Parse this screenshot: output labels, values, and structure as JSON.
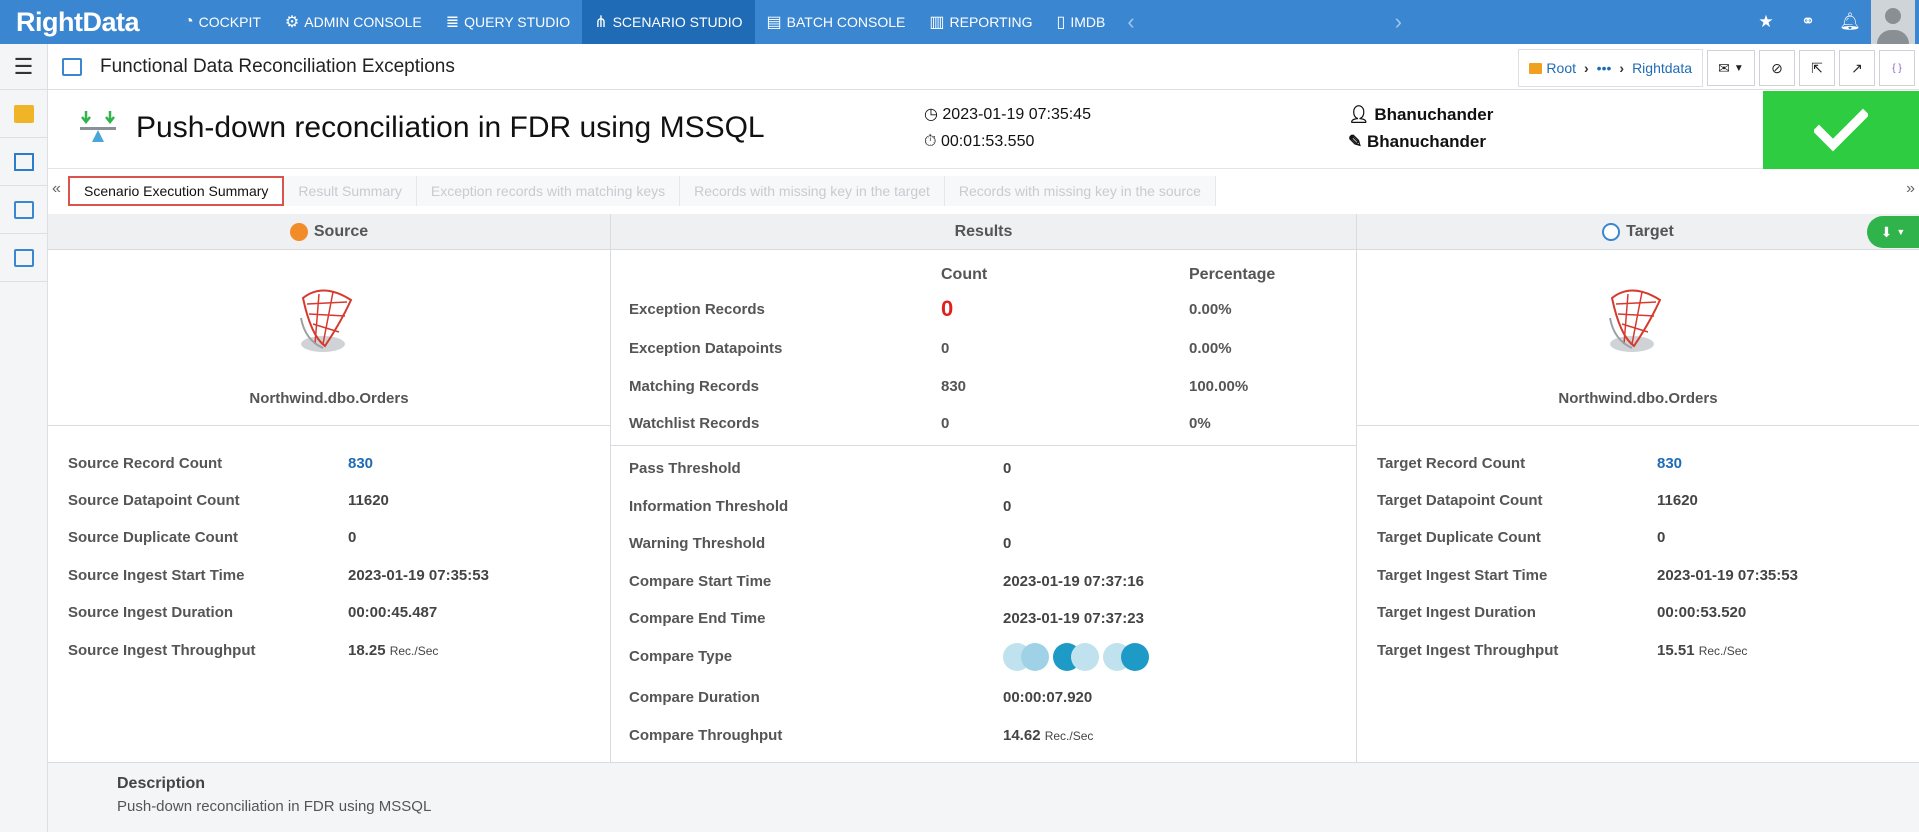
{
  "app": {
    "logo": "RightData"
  },
  "topnav": {
    "items": [
      {
        "label": "COCKPIT",
        "icon": "gauge-icon"
      },
      {
        "label": "ADMIN CONSOLE",
        "icon": "gear-icon"
      },
      {
        "label": "QUERY STUDIO",
        "icon": "database-icon"
      },
      {
        "label": "SCENARIO STUDIO",
        "icon": "sitemap-icon"
      },
      {
        "label": "BATCH CONSOLE",
        "icon": "stack-icon"
      },
      {
        "label": "REPORTING",
        "icon": "report-icon"
      },
      {
        "label": "IMDB",
        "icon": "columns-icon"
      }
    ],
    "active_index": 3,
    "colors": {
      "bar": "#3a86d1",
      "active": "#1f6bb5"
    }
  },
  "titlebar": {
    "title": "Functional Data Reconciliation Exceptions",
    "breadcrumb": {
      "root": "Root",
      "ellipsis": "•••",
      "current": "Rightdata"
    }
  },
  "header": {
    "title": "Push-down reconciliation in FDR using MSSQL",
    "timestamp": "2023-01-19 07:35:45",
    "duration": "00:01:53.550",
    "created_by": "Bhanuchander",
    "modified_by": "Bhanuchander",
    "status_color": "#2ecc40"
  },
  "tabs": [
    {
      "label": "Scenario Execution Summary",
      "active": true
    },
    {
      "label": "Result Summary",
      "active": false
    },
    {
      "label": "Exception records with matching keys",
      "active": false
    },
    {
      "label": "Records with missing key in the target",
      "active": false
    },
    {
      "label": "Records with missing key in the source",
      "active": false
    }
  ],
  "source": {
    "title": "Source",
    "db_name": "Northwind.dbo.Orders",
    "stats": [
      {
        "label": "Source Record Count",
        "value": "830",
        "link": true
      },
      {
        "label": "Source Datapoint Count",
        "value": "11620"
      },
      {
        "label": "Source Duplicate Count",
        "value": "0"
      },
      {
        "label": "Source Ingest Start Time",
        "value": "2023-01-19 07:35:53"
      },
      {
        "label": "Source Ingest Duration",
        "value": "00:00:45.487"
      },
      {
        "label": "Source Ingest Throughput",
        "value": "18.25",
        "unit": "Rec./Sec"
      }
    ]
  },
  "results": {
    "title": "Results",
    "col_count": "Count",
    "col_percentage": "Percentage",
    "rows": [
      {
        "label": "Exception Records",
        "count": "0",
        "percentage": "0.00%"
      },
      {
        "label": "Exception Datapoints",
        "count": "0",
        "percentage": "0.00%"
      },
      {
        "label": "Matching Records",
        "count": "830",
        "percentage": "100.00%"
      },
      {
        "label": "Watchlist Records",
        "count": "0",
        "percentage": "0%"
      }
    ],
    "details": [
      {
        "label": "Pass Threshold",
        "value": "0"
      },
      {
        "label": "Information Threshold",
        "value": "0"
      },
      {
        "label": "Warning Threshold",
        "value": "0"
      },
      {
        "label": "Compare Start Time",
        "value": "2023-01-19 07:37:16"
      },
      {
        "label": "Compare End Time",
        "value": "2023-01-19 07:37:23"
      },
      {
        "label": "Compare Type",
        "value": ""
      },
      {
        "label": "Compare Duration",
        "value": "00:00:07.920"
      },
      {
        "label": "Compare Throughput",
        "value": "14.62",
        "unit": "Rec./Sec"
      }
    ]
  },
  "target": {
    "title": "Target",
    "db_name": "Northwind.dbo.Orders",
    "stats": [
      {
        "label": "Target Record Count",
        "value": "830",
        "link": true
      },
      {
        "label": "Target Datapoint Count",
        "value": "11620"
      },
      {
        "label": "Target Duplicate Count",
        "value": "0"
      },
      {
        "label": "Target Ingest Start Time",
        "value": "2023-01-19 07:35:53"
      },
      {
        "label": "Target Ingest Duration",
        "value": "00:00:53.520"
      },
      {
        "label": "Target Ingest Throughput",
        "value": "15.51",
        "unit": "Rec./Sec"
      }
    ]
  },
  "description": {
    "label": "Description",
    "value": "Push-down reconciliation in FDR using MSSQL"
  }
}
